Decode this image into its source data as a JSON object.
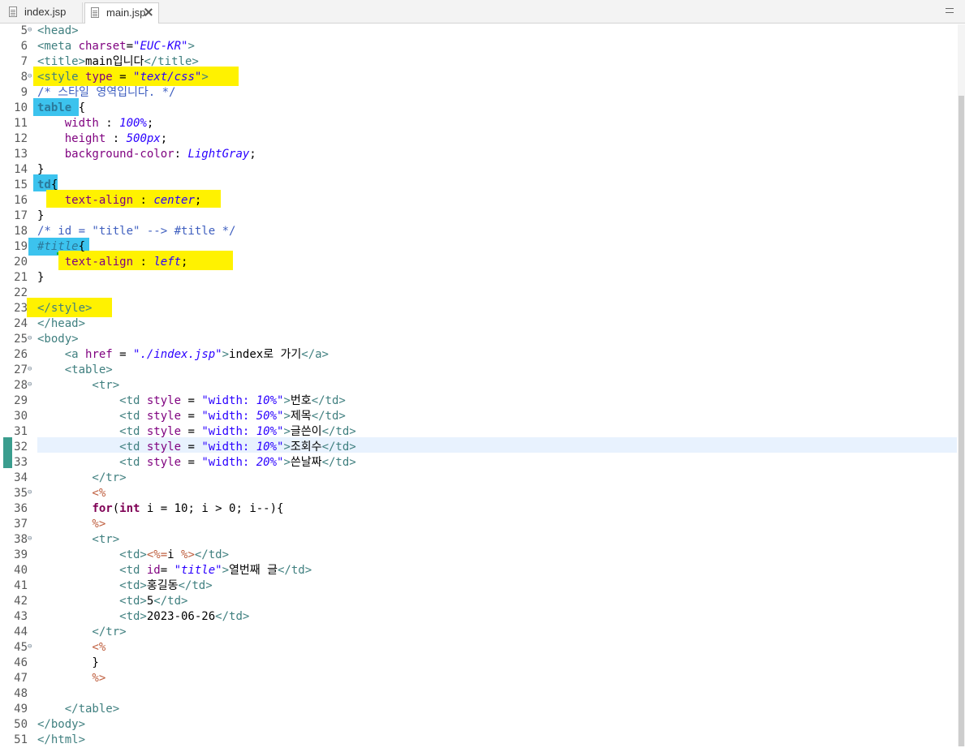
{
  "tabs": [
    {
      "label": "index.jsp",
      "icon": "jsp-file-icon",
      "active": false
    },
    {
      "label": "main.jsp",
      "icon": "jsp-file-icon",
      "active": true
    }
  ],
  "editor": {
    "current_line": 32,
    "lines": [
      {
        "n": "5",
        "fold": true
      },
      {
        "n": "6",
        "fold": false
      },
      {
        "n": "7",
        "fold": false
      },
      {
        "n": "8",
        "fold": true
      },
      {
        "n": "9",
        "fold": false
      },
      {
        "n": "10",
        "fold": false
      },
      {
        "n": "11",
        "fold": false
      },
      {
        "n": "12",
        "fold": false
      },
      {
        "n": "13",
        "fold": false
      },
      {
        "n": "14",
        "fold": false
      },
      {
        "n": "15",
        "fold": false
      },
      {
        "n": "16",
        "fold": false
      },
      {
        "n": "17",
        "fold": false
      },
      {
        "n": "18",
        "fold": false
      },
      {
        "n": "19",
        "fold": false
      },
      {
        "n": "20",
        "fold": false
      },
      {
        "n": "21",
        "fold": false
      },
      {
        "n": "22",
        "fold": false
      },
      {
        "n": "23",
        "fold": false
      },
      {
        "n": "24",
        "fold": false
      },
      {
        "n": "25",
        "fold": true
      },
      {
        "n": "26",
        "fold": false
      },
      {
        "n": "27",
        "fold": true
      },
      {
        "n": "28",
        "fold": true
      },
      {
        "n": "29",
        "fold": false
      },
      {
        "n": "30",
        "fold": false
      },
      {
        "n": "31",
        "fold": false
      },
      {
        "n": "32",
        "fold": false
      },
      {
        "n": "33",
        "fold": false
      },
      {
        "n": "34",
        "fold": false
      },
      {
        "n": "35",
        "fold": true
      },
      {
        "n": "36",
        "fold": false
      },
      {
        "n": "37",
        "fold": false
      },
      {
        "n": "38",
        "fold": true
      },
      {
        "n": "39",
        "fold": false
      },
      {
        "n": "40",
        "fold": false
      },
      {
        "n": "41",
        "fold": false
      },
      {
        "n": "42",
        "fold": false
      },
      {
        "n": "43",
        "fold": false
      },
      {
        "n": "44",
        "fold": false
      },
      {
        "n": "45",
        "fold": true
      },
      {
        "n": "46",
        "fold": false
      },
      {
        "n": "47",
        "fold": false
      },
      {
        "n": "48",
        "fold": false
      },
      {
        "n": "49",
        "fold": false
      },
      {
        "n": "50",
        "fold": false
      },
      {
        "n": "51",
        "fold": false
      }
    ],
    "code": {
      "l5": [
        "<head>"
      ],
      "l6": [
        "<meta ",
        "charset",
        "=",
        "\"EUC-KR\"",
        ">"
      ],
      "l7": [
        "<title>",
        "main입니다",
        "</title>"
      ],
      "l8": [
        "<style ",
        "type",
        " = ",
        "\"text/css\"",
        ">"
      ],
      "l9": [
        "/* 스타일 영역입니다. */"
      ],
      "l10": [
        "table",
        " {"
      ],
      "l11": [
        "    width",
        " : ",
        "100%",
        ";"
      ],
      "l12": [
        "    height",
        " : ",
        "500px",
        ";"
      ],
      "l13": [
        "    background-color",
        ": ",
        "LightGray",
        ";"
      ],
      "l14": [
        "}"
      ],
      "l15": [
        "td",
        "{"
      ],
      "l16": [
        "    text-align",
        " : ",
        "center",
        ";"
      ],
      "l17": [
        "}"
      ],
      "l18": [
        "/* id = \"title\" --> #title */"
      ],
      "l19": [
        "#title",
        "{"
      ],
      "l20": [
        "    text-align",
        " : ",
        "left",
        ";"
      ],
      "l21": [
        "}"
      ],
      "l22": [
        ""
      ],
      "l23": [
        "</style>"
      ],
      "l24": [
        "</head>"
      ],
      "l25": [
        "<body>"
      ],
      "l26": [
        "    <a ",
        "href",
        " = ",
        "\"./index.jsp\"",
        ">",
        "index로 가기",
        "</a>"
      ],
      "l27": [
        "    <table>"
      ],
      "l28": [
        "        <tr>"
      ],
      "l29": [
        "            <td ",
        "style",
        " = ",
        "\"width: ",
        "10%",
        "\"",
        ">",
        "번호",
        "</td>"
      ],
      "l30": [
        "            <td ",
        "style",
        " = ",
        "\"width: ",
        "50%",
        "\"",
        ">",
        "제목",
        "</td>"
      ],
      "l31": [
        "            <td ",
        "style",
        " = ",
        "\"width: ",
        "10%",
        "\"",
        ">",
        "글쓴이",
        "</td>"
      ],
      "l32": [
        "            <td ",
        "style",
        " = ",
        "\"width: ",
        "10%",
        "\"",
        ">",
        "조회수",
        "</td>"
      ],
      "l33": [
        "            <td ",
        "style",
        " = ",
        "\"width: ",
        "20%",
        "\"",
        ">",
        "쓴날짜",
        "</td>"
      ],
      "l34": [
        "        </tr>"
      ],
      "l35": [
        "        <%"
      ],
      "l36": [
        "        ",
        "for",
        "(",
        "int",
        " i = 10; i > 0; i--){"
      ],
      "l37": [
        "        %>"
      ],
      "l38": [
        "        <tr>"
      ],
      "l39": [
        "            <td>",
        "<%=",
        "i ",
        "%>",
        "</td>"
      ],
      "l40": [
        "            <td ",
        "id",
        "= ",
        "\"title\"",
        ">",
        "열번째 글",
        "</td>"
      ],
      "l41": [
        "            <td>",
        "홍길동",
        "</td>"
      ],
      "l42": [
        "            <td>",
        "5",
        "</td>"
      ],
      "l43": [
        "            <td>",
        "2023-06-26",
        "</td>"
      ],
      "l44": [
        "        </tr>"
      ],
      "l45": [
        "        <%"
      ],
      "l46": [
        "        }"
      ],
      "l47": [
        "        %>"
      ],
      "l48": [
        ""
      ],
      "l49": [
        "    </table>"
      ],
      "l50": [
        "</body>"
      ],
      "l51": [
        "</html>"
      ]
    }
  },
  "colors": {
    "highlight_yellow": "#fff200",
    "highlight_cyan": "#3cc3ee",
    "current_line": "#e8f2fe",
    "tag": "#3f7f7f",
    "attribute": "#7f007f",
    "string": "#2a00ff",
    "comment": "#3f5fbf",
    "keyword": "#7f0055",
    "jsp_delimiter": "#bf5f3f"
  }
}
